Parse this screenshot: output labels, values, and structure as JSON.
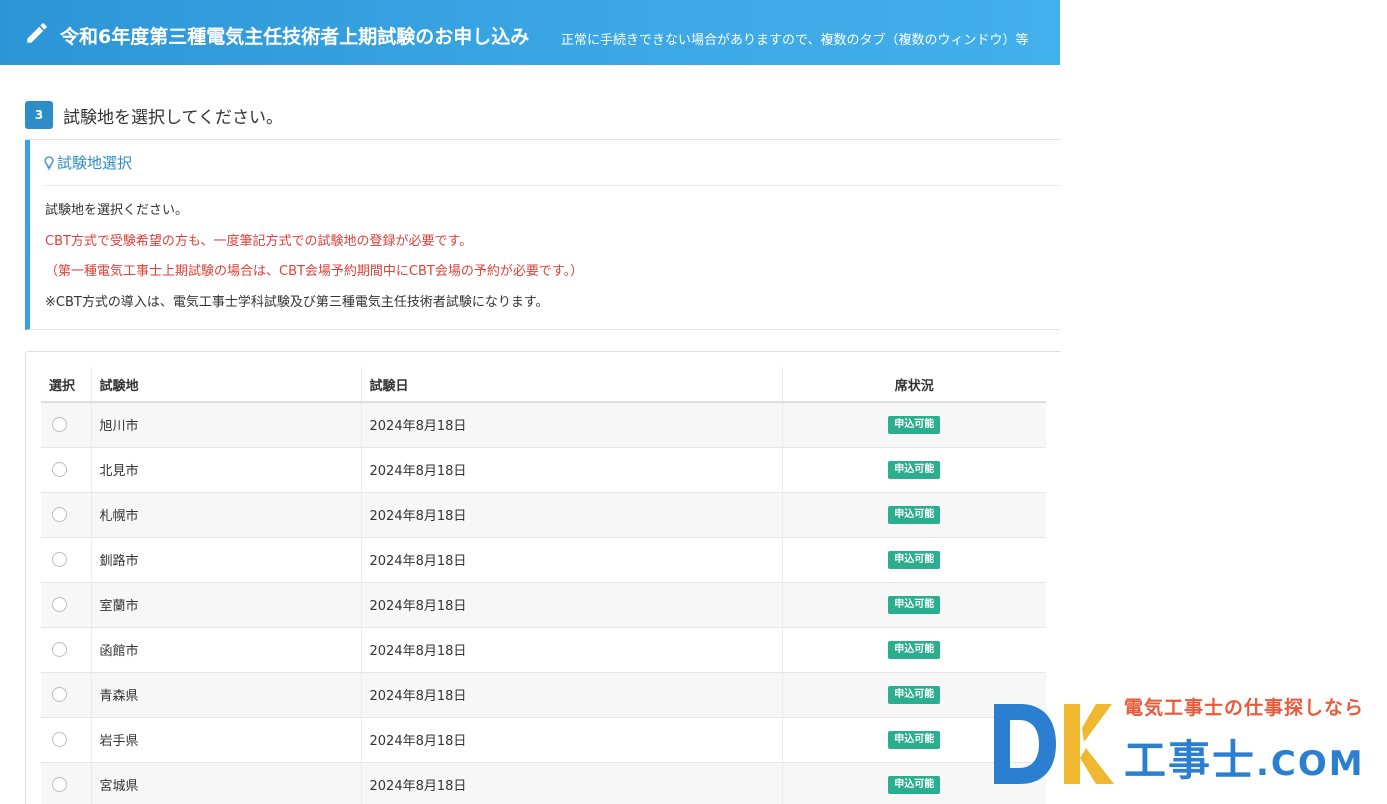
{
  "header": {
    "title": "令和6年度第三種電気主任技術者上期試験のお申し込み",
    "notice": "正常に手続きできない場合がありますので、複数のタブ（複数のウィンドウ）等"
  },
  "step": {
    "number": "3",
    "label": "試験地を選択してください。"
  },
  "info": {
    "title": "試験地選択",
    "line1": "試験地を選択ください。",
    "line2": "CBT方式で受験希望の方も、一度筆記方式での試験地の登録が必要です。",
    "line3": "（第一種電気工事士上期試験の場合は、CBT会場予約期間中にCBT会場の予約が必要です。）",
    "line4": "※CBT方式の導入は、電気工事士学科試験及び第三種電気主任技術者試験になります。"
  },
  "table": {
    "headers": {
      "select": "選択",
      "place": "試験地",
      "date": "試験日",
      "status": "席状況"
    },
    "rows": [
      {
        "place": "旭川市",
        "date": "2024年8月18日",
        "status": "申込可能"
      },
      {
        "place": "北見市",
        "date": "2024年8月18日",
        "status": "申込可能"
      },
      {
        "place": "札幌市",
        "date": "2024年8月18日",
        "status": "申込可能"
      },
      {
        "place": "釧路市",
        "date": "2024年8月18日",
        "status": "申込可能"
      },
      {
        "place": "室蘭市",
        "date": "2024年8月18日",
        "status": "申込可能"
      },
      {
        "place": "函館市",
        "date": "2024年8月18日",
        "status": "申込可能"
      },
      {
        "place": "青森県",
        "date": "2024年8月18日",
        "status": "申込可能"
      },
      {
        "place": "岩手県",
        "date": "2024年8月18日",
        "status": "申込可能"
      },
      {
        "place": "宮城県",
        "date": "2024年8月18日",
        "status": "申込可能"
      }
    ]
  },
  "watermark": {
    "tagline": "電気工事士の仕事探しなら",
    "brand": "工事士",
    "domain": ".COM",
    "logo_letters": "DK"
  },
  "colors": {
    "header_blue": "#2c95d6",
    "accent_blue": "#2c8dc9",
    "warning_red": "#e0403a",
    "status_green": "#2aae8e"
  }
}
